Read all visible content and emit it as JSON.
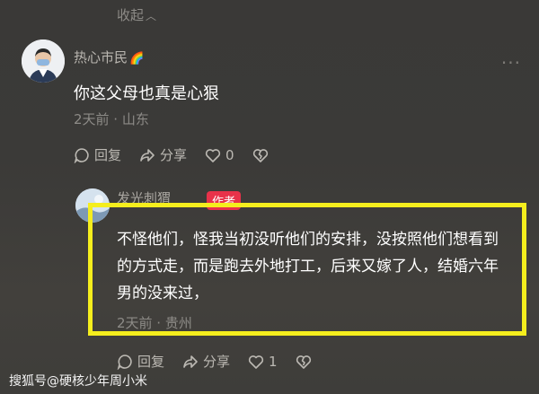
{
  "collapse": {
    "label": "收起",
    "icon": "chevron-up-icon"
  },
  "comment": {
    "username": "热心市民",
    "badge_emoji": "🌈",
    "text": "你这父母也真是心狠",
    "meta": "2天前 · 山东",
    "actions": {
      "reply": "回复",
      "share": "分享",
      "like_count": "0"
    }
  },
  "reply": {
    "username": "发光刺猬",
    "author_badge": "作者",
    "text": "不怪他们，怪我当初没听他们的安排，没按照他们想看到的方式走，而是跑去外地打工，后来又嫁了人，结婚六年男的没来过，",
    "meta": "2天前 · 贵州",
    "actions": {
      "reply": "回复",
      "share": "分享",
      "like_count": "1"
    }
  },
  "watermark": "搜狐号@硬核少年周小米",
  "colors": {
    "highlight": "#f5ee1d",
    "author_badge": "#e8324a"
  }
}
